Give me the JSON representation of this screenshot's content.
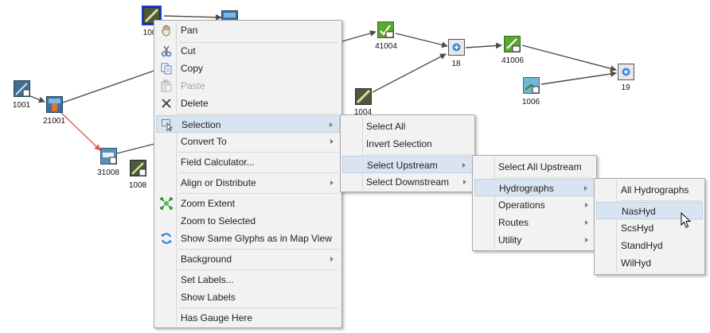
{
  "colors": {
    "edge": "#4d4d4d",
    "selected_edge": "#e05a4f",
    "menu_bg": "#f2f2f2",
    "highlight": "#d9e4f2",
    "selection_box": "#1f3ccf"
  },
  "nodes": [
    {
      "id": "1001",
      "label": "1001",
      "icon": "hydrograph-node-icon"
    },
    {
      "id": "21001",
      "label": "21001",
      "icon": "reservoir-node-icon"
    },
    {
      "id": "1006top",
      "label": "100",
      "icon": "stream-node-icon",
      "selected": true
    },
    {
      "id": "hidden-top",
      "label": "",
      "icon": "reservoir-node-icon"
    },
    {
      "id": "31008",
      "label": "31008",
      "icon": "pipe-node-icon"
    },
    {
      "id": "1008",
      "label": "1008",
      "icon": "hydrograph-node-icon"
    },
    {
      "id": "41004",
      "label": "41004",
      "icon": "routing-node-icon"
    },
    {
      "id": "1004",
      "label": "1004",
      "icon": "stream-node-icon"
    },
    {
      "id": "18",
      "label": "18",
      "icon": "junction-node-icon"
    },
    {
      "id": "41006",
      "label": "41006",
      "icon": "routing-node-icon"
    },
    {
      "id": "1006",
      "label": "1006",
      "icon": "hydrograph-node-icon"
    },
    {
      "id": "19",
      "label": "19",
      "icon": "junction-node-icon"
    }
  ],
  "context_menu": {
    "items": [
      {
        "label": "Pan",
        "icon": "hand-icon"
      },
      {
        "label": "Cut",
        "icon": "scissors-icon"
      },
      {
        "label": "Copy",
        "icon": "copy-icon"
      },
      {
        "label": "Paste",
        "icon": "paste-icon",
        "disabled": true
      },
      {
        "label": "Delete",
        "icon": "delete-x-icon"
      },
      {
        "label": "Selection",
        "icon": "selection-cursor-icon",
        "submenu": true,
        "highlighted": true
      },
      {
        "label": "Convert To",
        "submenu": true
      },
      {
        "label": "Field Calculator..."
      },
      {
        "label": "Align or Distribute",
        "submenu": true
      },
      {
        "label": "Zoom Extent",
        "icon": "zoom-extent-icon"
      },
      {
        "label": "Zoom to Selected"
      },
      {
        "label": "Show Same Glyphs as in Map View",
        "icon": "refresh-icon"
      },
      {
        "label": "Background",
        "submenu": true
      },
      {
        "label": "Set Labels..."
      },
      {
        "label": "Show Labels"
      },
      {
        "label": "Has Gauge Here"
      }
    ]
  },
  "selection_menu": {
    "items": [
      {
        "label": "Select All"
      },
      {
        "label": "Invert Selection"
      },
      {
        "label": "Select Upstream",
        "submenu": true,
        "highlighted": true
      },
      {
        "label": "Select Downstream",
        "submenu": true
      }
    ]
  },
  "upstream_menu": {
    "items": [
      {
        "label": "Select All Upstream"
      },
      {
        "label": "Hydrographs",
        "submenu": true,
        "highlighted": true
      },
      {
        "label": "Operations",
        "submenu": true
      },
      {
        "label": "Routes",
        "submenu": true
      },
      {
        "label": "Utility",
        "submenu": true
      }
    ]
  },
  "hydrographs_menu": {
    "items": [
      {
        "label": "All Hydrographs"
      },
      {
        "label": "NasHyd",
        "highlighted": true
      },
      {
        "label": "ScsHyd"
      },
      {
        "label": "StandHyd"
      },
      {
        "label": "WilHyd"
      }
    ]
  }
}
